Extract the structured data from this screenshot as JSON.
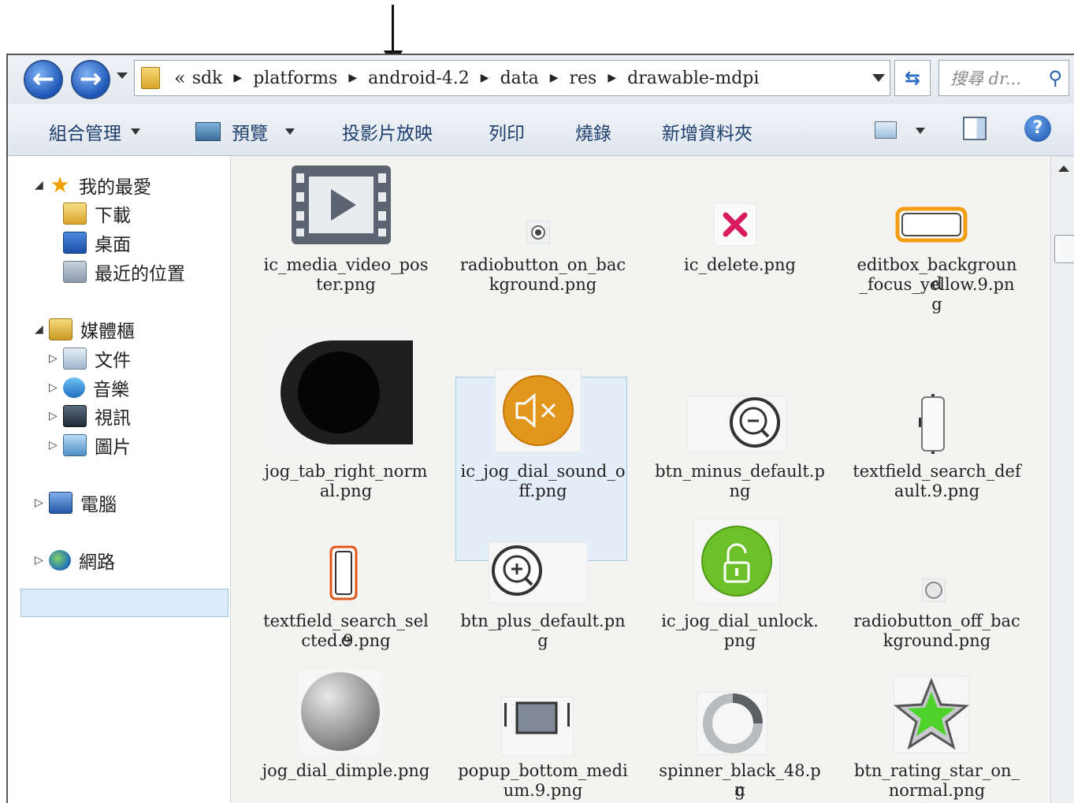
{
  "address_bar": {
    "overflow_glyph": "«",
    "crumbs": [
      "sdk",
      "platforms",
      "android-4.2",
      "data",
      "res",
      "drawable-mdpi"
    ],
    "search_placeholder": "搜尋 dr..."
  },
  "toolbar": {
    "organize": "組合管理",
    "preview": "預覽",
    "slideshow": "投影片放映",
    "print": "列印",
    "burn": "燒錄",
    "new_folder": "新增資料夾"
  },
  "nav": {
    "favorites": "我的最愛",
    "downloads": "下載",
    "desktop": "桌面",
    "recent": "最近的位置",
    "libraries": "媒體櫃",
    "documents": "文件",
    "music": "音樂",
    "videos": "視訊",
    "pictures": "圖片",
    "computer": "電腦",
    "network": "網路"
  },
  "files": [
    {
      "name_line1": "ic_media_video_pos",
      "name_line2": "ter.png",
      "name_line3": ""
    },
    {
      "name_line1": "radiobutton_on_bac",
      "name_line2": "kground.png",
      "name_line3": ""
    },
    {
      "name_line1": "ic_delete.png",
      "name_line2": "",
      "name_line3": ""
    },
    {
      "name_line1": "editbox_background",
      "name_line2": "_focus_yellow.9.pn",
      "name_line3": "g"
    },
    {
      "name_line1": "jog_tab_right_norm",
      "name_line2": "al.png",
      "name_line3": ""
    },
    {
      "name_line1": "ic_jog_dial_sound_o",
      "name_line2": "ff.png",
      "name_line3": ""
    },
    {
      "name_line1": "btn_minus_default.p",
      "name_line2": "ng",
      "name_line3": ""
    },
    {
      "name_line1": "textfield_search_def",
      "name_line2": "ault.9.png",
      "name_line3": ""
    },
    {
      "name_line1": "textfield_search_sele",
      "name_line2": "cted.9.png",
      "name_line3": ""
    },
    {
      "name_line1": "btn_plus_default.pn",
      "name_line2": "g",
      "name_line3": ""
    },
    {
      "name_line1": "ic_jog_dial_unlock.",
      "name_line2": "png",
      "name_line3": ""
    },
    {
      "name_line1": "radiobutton_off_bac",
      "name_line2": "kground.png",
      "name_line3": ""
    },
    {
      "name_line1": "jog_dial_dimple.png",
      "name_line2": "",
      "name_line3": ""
    },
    {
      "name_line1": "popup_bottom_medi",
      "name_line2": "um.9.png",
      "name_line3": ""
    },
    {
      "name_line1": "spinner_black_48.pn",
      "name_line2": "g",
      "name_line3": ""
    },
    {
      "name_line1": "btn_rating_star_on_",
      "name_line2": "normal.png",
      "name_line3": ""
    }
  ],
  "selected_file_index": 5,
  "colors": {
    "accent": "#1e56b8",
    "selection": "#dcebfa"
  }
}
